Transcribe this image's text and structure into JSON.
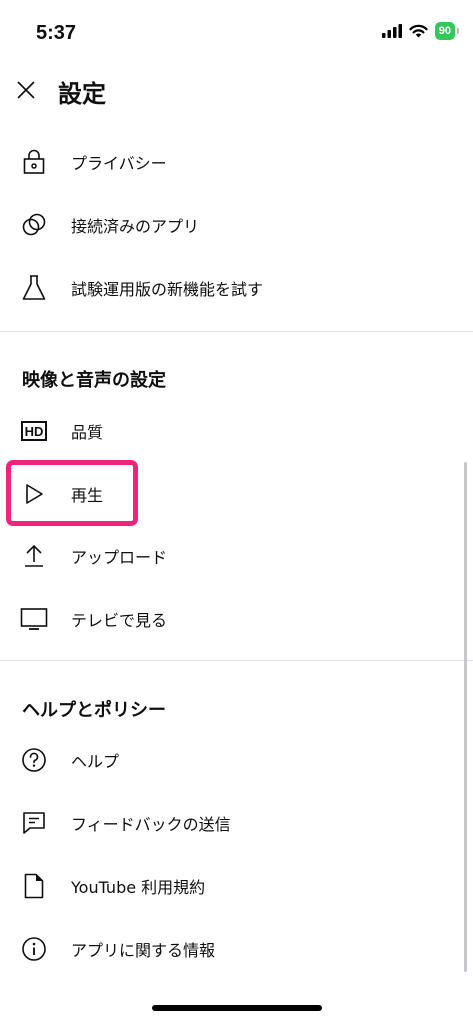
{
  "status_bar": {
    "time": "5:37",
    "battery": "90",
    "battery_color": "#34c759"
  },
  "header": {
    "title": "設定",
    "close_icon": "close-icon"
  },
  "top_items": [
    {
      "label": "プライバシー",
      "icon": "lock-icon"
    },
    {
      "label": "接続済みのアプリ",
      "icon": "connected-apps-icon"
    },
    {
      "label": "試験運用版の新機能を試す",
      "icon": "flask-icon"
    }
  ],
  "video_audio_section": {
    "title": "映像と音声の設定",
    "items": [
      {
        "label": "品質",
        "icon": "hd-icon"
      },
      {
        "label": "再生",
        "icon": "play-icon"
      },
      {
        "label": "アップロード",
        "icon": "upload-icon"
      },
      {
        "label": "テレビで見る",
        "icon": "tv-icon"
      }
    ]
  },
  "help_section": {
    "title": "ヘルプとポリシー",
    "items": [
      {
        "label": "ヘルプ",
        "icon": "help-icon"
      },
      {
        "label": "フィードバックの送信",
        "icon": "feedback-icon"
      },
      {
        "label": "YouTube 利用規約",
        "icon": "document-icon"
      },
      {
        "label": "アプリに関する情報",
        "icon": "info-icon"
      }
    ]
  },
  "highlight_color": "#f0247a"
}
